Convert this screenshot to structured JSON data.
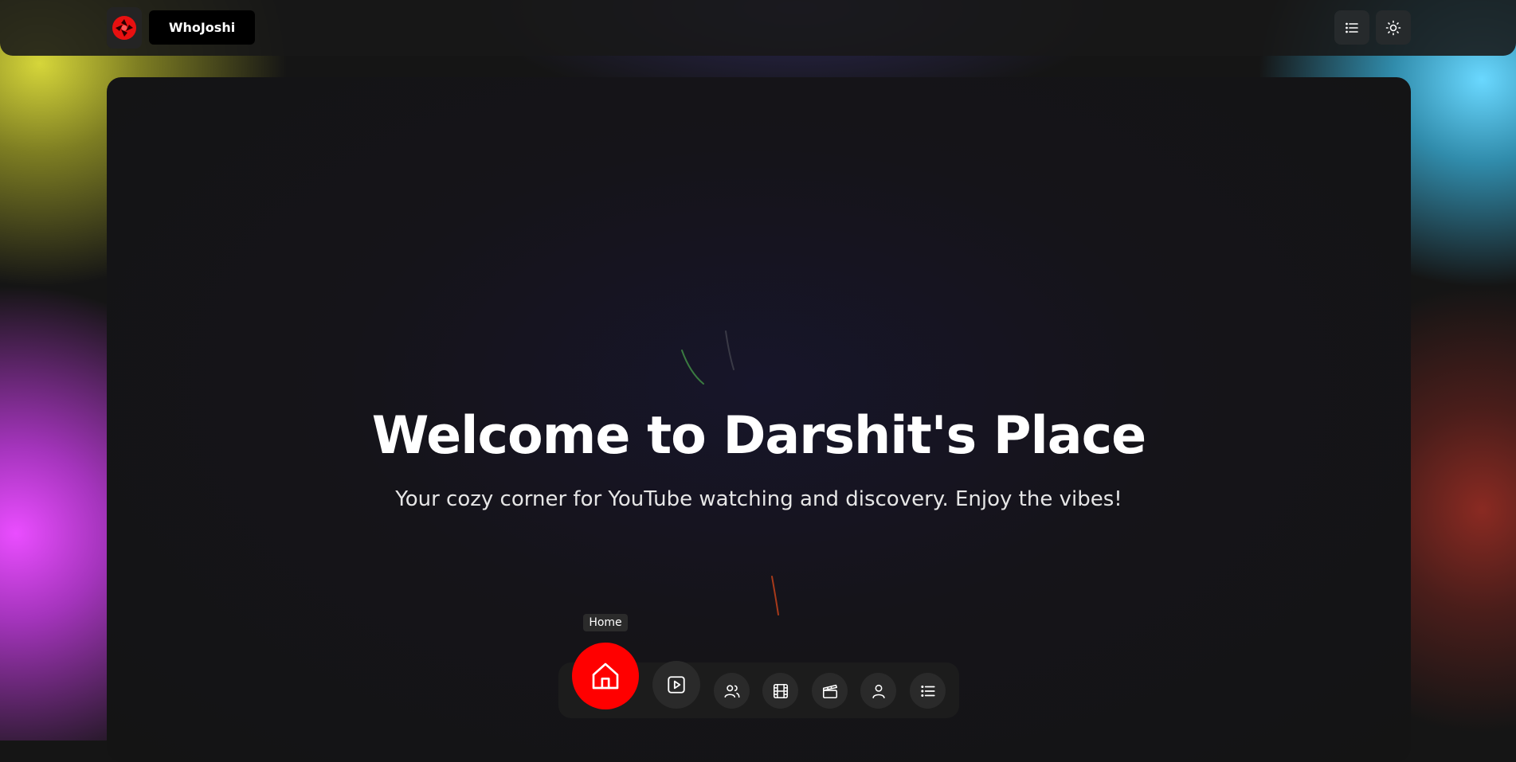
{
  "header": {
    "brand_name": "WhoJoshi",
    "logo_icon": "aperture-logo-icon",
    "menu_icon": "list-icon",
    "theme_icon": "sun-icon"
  },
  "hero": {
    "title": "Welcome to Darshit's Place",
    "subtitle": "Your cozy corner for YouTube watching and discovery. Enjoy the vibes!"
  },
  "dock": {
    "active_tooltip": "Home",
    "items": [
      {
        "name": "home",
        "icon": "home-icon",
        "active": true
      },
      {
        "name": "play",
        "icon": "play-square-icon",
        "active": false
      },
      {
        "name": "people",
        "icon": "users-icon",
        "active": false
      },
      {
        "name": "film",
        "icon": "film-icon",
        "active": false
      },
      {
        "name": "clapperboard",
        "icon": "clapperboard-icon",
        "active": false
      },
      {
        "name": "profile",
        "icon": "user-icon",
        "active": false
      },
      {
        "name": "list",
        "icon": "list-icon",
        "active": false
      }
    ]
  },
  "colors": {
    "accent": "#ff0000",
    "background": "#151515",
    "panel": "#141414"
  }
}
